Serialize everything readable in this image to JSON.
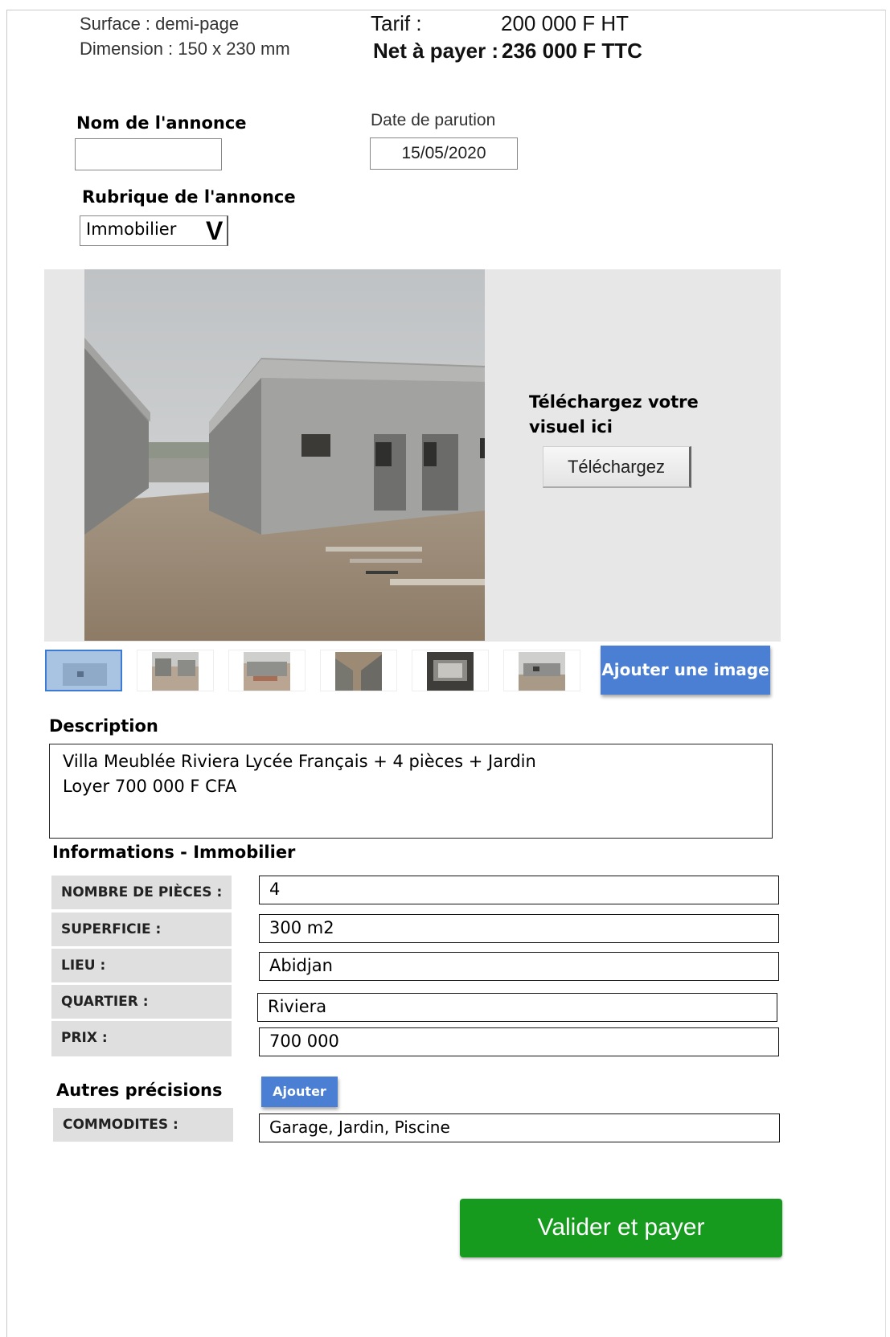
{
  "header": {
    "surface": "Surface : demi-page",
    "dimension": "Dimension : 150 x 230 mm",
    "tarif_label": "Tarif :",
    "tarif_value": "200 000 F HT",
    "net_label": "Net à payer :",
    "net_value": "236 000 F TTC"
  },
  "form": {
    "nom_label": "Nom de l'annonce",
    "nom_value": "",
    "date_label": "Date de parution",
    "date_value": "15/05/2020",
    "rubrique_label": "Rubrique de l'annonce",
    "rubrique_value": "Immobilier",
    "rubrique_chevron": "V"
  },
  "upload": {
    "title_line1": "Téléchargez votre",
    "title_line2": "visuel ici",
    "button_label": "Téléchargez"
  },
  "gallery": {
    "thumbnails": [
      {
        "name": "thumbnail-1",
        "selected": true
      },
      {
        "name": "thumbnail-2",
        "selected": false
      },
      {
        "name": "thumbnail-3",
        "selected": false
      },
      {
        "name": "thumbnail-4",
        "selected": false
      },
      {
        "name": "thumbnail-5",
        "selected": false
      },
      {
        "name": "thumbnail-6",
        "selected": false
      }
    ],
    "add_image_label": "Ajouter une image"
  },
  "description": {
    "label": "Description",
    "line1": "Villa Meublée Riviera Lycée Français + 4 pièces + Jardin",
    "line2": "Loyer 700 000 F CFA"
  },
  "informations": {
    "title": "Informations - Immobilier",
    "rows": [
      {
        "label": "NOMBRE DE PIÈCES :",
        "value": "4"
      },
      {
        "label": "SUPERFICIE :",
        "value": "300 m2"
      },
      {
        "label": "LIEU :",
        "value": "Abidjan"
      },
      {
        "label": "QUARTIER :",
        "value": "Riviera"
      },
      {
        "label": "PRIX :",
        "value": "700 000"
      }
    ]
  },
  "autres": {
    "label": "Autres précisions",
    "add_label": "Ajouter",
    "commodites_label": "COMMODITES :",
    "commodites_value": "Garage, Jardin, Piscine"
  },
  "submit_label": "Valider et payer",
  "colors": {
    "accent_blue": "#4a7fd4",
    "submit_green": "#169b1f",
    "label_grey": "#dfdfdf"
  }
}
